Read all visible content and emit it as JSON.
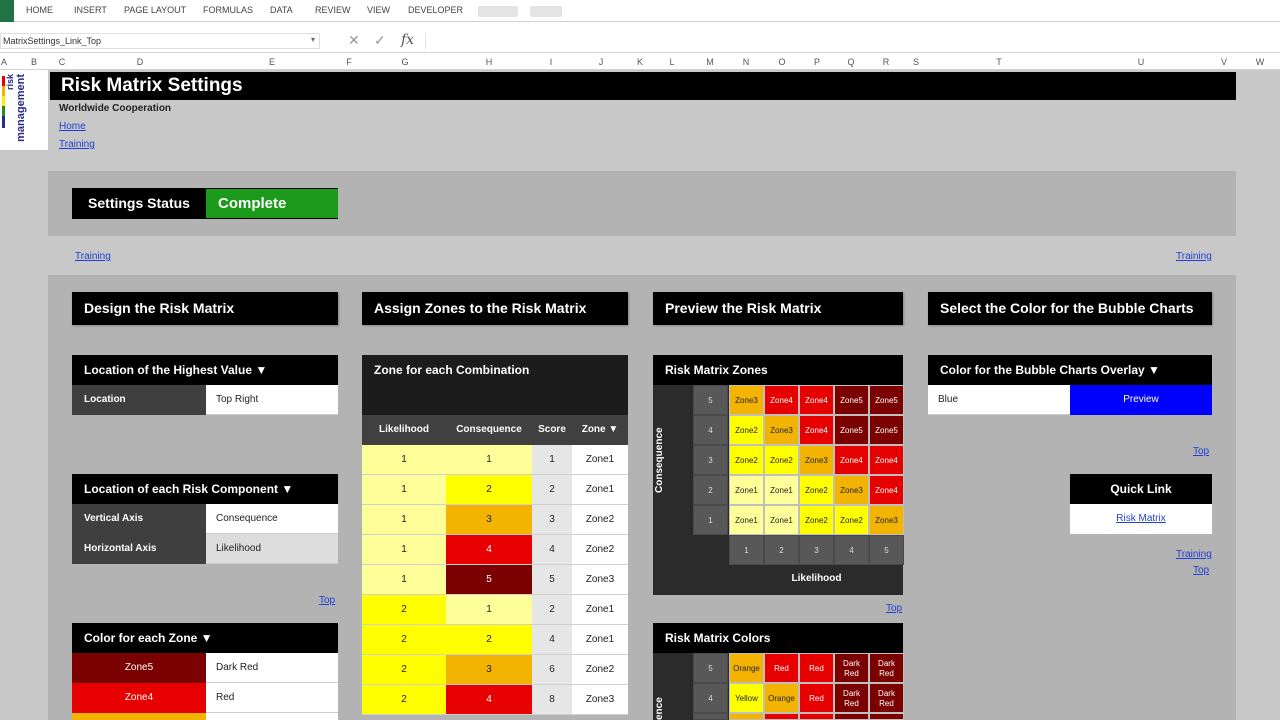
{
  "ribbon": {
    "tabs": [
      "HOME",
      "INSERT",
      "PAGE LAYOUT",
      "FORMULAS",
      "DATA",
      "REVIEW",
      "VIEW",
      "DEVELOPER"
    ]
  },
  "formula_bar": {
    "name_box": "MatrixSettings_Link_Top",
    "fx": "fx",
    "cancel": "✕",
    "enter": "✓",
    "dropdown": "▾"
  },
  "columns": [
    "A",
    "B",
    "C",
    "D",
    "E",
    "F",
    "G",
    "H",
    "I",
    "J",
    "K",
    "L",
    "M",
    "N",
    "O",
    "P",
    "Q",
    "R",
    "S",
    "T",
    "U",
    "V",
    "W"
  ],
  "colors": {
    "complete_green": "#1b9a1b",
    "preview_blue": "#0000ff",
    "pale_yellow": "#ffff9a",
    "yellow": "#ffff00",
    "orange": "#f2b400",
    "red": "#e60000",
    "dark_red": "#7b0000"
  },
  "page": {
    "title": "Risk Matrix Settings",
    "organization": "Worldwide Cooperation",
    "home_link": "Home",
    "training_link": "Training",
    "logo_text_small": "risk",
    "logo_text_large": "management"
  },
  "status": {
    "label": "Settings Status",
    "value": "Complete"
  },
  "links": {
    "training": "Training",
    "top": "Top"
  },
  "design": {
    "header": "Design the Risk Matrix",
    "location_title": "Location of the Highest Value ▼",
    "location_label": "Location",
    "location_value": "Top Right",
    "component_title": "Location of each Risk Component ▼",
    "vertical_label": "Vertical Axis",
    "vertical_value": "Consequence",
    "horizontal_label": "Horizontal Axis",
    "horizontal_value": "Likelihood",
    "color_title": "Color for each Zone ▼",
    "zone_colors": [
      {
        "zone": "Zone5",
        "color": "Dark Red"
      },
      {
        "zone": "Zone4",
        "color": "Red"
      }
    ]
  },
  "assign": {
    "header": "Assign Zones to the Risk Matrix",
    "table_title": "Zone for each Combination",
    "columns": [
      "Likelihood",
      "Consequence",
      "Score",
      "Zone ▼"
    ],
    "rows": [
      {
        "likelihood": "1",
        "consequence": "1",
        "score": "1",
        "zone": "Zone1"
      },
      {
        "likelihood": "1",
        "consequence": "2",
        "score": "2",
        "zone": "Zone1"
      },
      {
        "likelihood": "1",
        "consequence": "3",
        "score": "3",
        "zone": "Zone2"
      },
      {
        "likelihood": "1",
        "consequence": "4",
        "score": "4",
        "zone": "Zone2"
      },
      {
        "likelihood": "1",
        "consequence": "5",
        "score": "5",
        "zone": "Zone3"
      },
      {
        "likelihood": "2",
        "consequence": "1",
        "score": "2",
        "zone": "Zone1"
      },
      {
        "likelihood": "2",
        "consequence": "2",
        "score": "4",
        "zone": "Zone1"
      },
      {
        "likelihood": "2",
        "consequence": "3",
        "score": "6",
        "zone": "Zone2"
      },
      {
        "likelihood": "2",
        "consequence": "4",
        "score": "8",
        "zone": "Zone3"
      }
    ]
  },
  "preview": {
    "header": "Preview the Risk Matrix",
    "zones_title": "Risk Matrix Zones",
    "colors_title": "Risk Matrix Colors",
    "y_axis": "Consequence",
    "y_axis_clipped": "ence",
    "x_axis": "Likelihood",
    "levels": [
      "5",
      "4",
      "3",
      "2",
      "1"
    ],
    "x_levels": [
      "1",
      "2",
      "3",
      "4",
      "5"
    ],
    "zones": [
      [
        "Zone3",
        "Zone4",
        "Zone4",
        "Zone5",
        "Zone5"
      ],
      [
        "Zone2",
        "Zone3",
        "Zone4",
        "Zone5",
        "Zone5"
      ],
      [
        "Zone2",
        "Zone2",
        "Zone3",
        "Zone4",
        "Zone4"
      ],
      [
        "Zone1",
        "Zone1",
        "Zone2",
        "Zone3",
        "Zone4"
      ],
      [
        "Zone1",
        "Zone1",
        "Zone2",
        "Zone2",
        "Zone3"
      ]
    ],
    "color_rows": [
      [
        "Orange",
        "Red",
        "Red",
        "Dark Red",
        "Dark Red"
      ],
      [
        "Yellow",
        "Orange",
        "Red",
        "Dark Red",
        "Dark Red"
      ]
    ]
  },
  "bubble": {
    "header": "Select the Color for the Bubble Charts",
    "overlay_title": "Color for the Bubble Charts Overlay ▼",
    "color_value": "Blue",
    "preview_label": "Preview",
    "quick_link_title": "Quick Link",
    "quick_link_value": "Risk Matrix"
  }
}
